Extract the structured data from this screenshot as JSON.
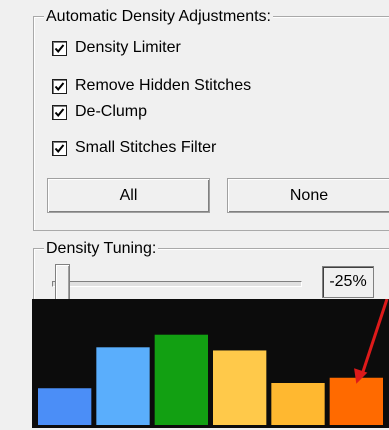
{
  "adjustments": {
    "title": "Automatic Density Adjustments:",
    "options": [
      {
        "label": "Density Limiter",
        "checked": true
      },
      {
        "label": "Remove Hidden Stitches",
        "checked": true
      },
      {
        "label": "De-Clump",
        "checked": true
      },
      {
        "label": "Small Stitches Filter",
        "checked": true
      }
    ],
    "all_button": "All",
    "none_button": "None"
  },
  "tuning": {
    "title": "Density Tuning:",
    "value": "-25%",
    "slider_level": 0.05
  },
  "colors": {
    "chart_background": "#0c0c0c",
    "arrow": "#dd1a1a"
  },
  "chart_data": {
    "type": "bar",
    "values": [
      35,
      74,
      86,
      71,
      40,
      45
    ],
    "colors": [
      "#4b8ef7",
      "#5aaefc",
      "#12a012",
      "#ffc94a",
      "#ffb830",
      "#ff6a00"
    ],
    "ylim": [
      0,
      100
    ]
  }
}
